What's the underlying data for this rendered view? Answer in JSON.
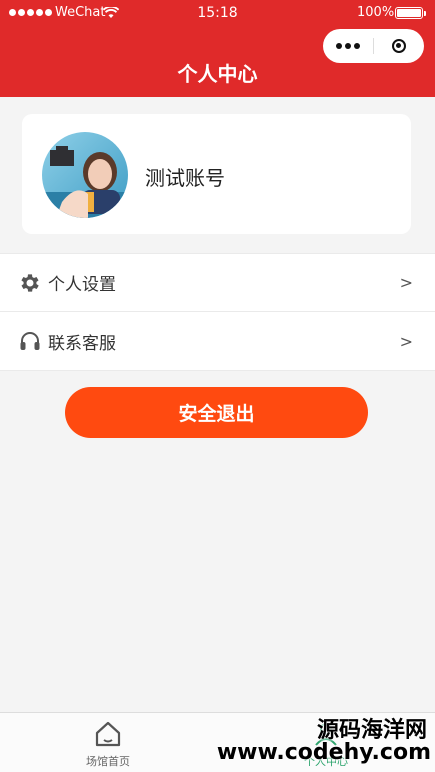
{
  "status_bar": {
    "carrier": "WeChat",
    "time": "15:18",
    "battery": "100%"
  },
  "nav": {
    "title": "个人中心"
  },
  "profile": {
    "name": "测试账号"
  },
  "menu": {
    "items": [
      {
        "label": "个人设置",
        "icon": "gear-icon",
        "arrow": ">"
      },
      {
        "label": "联系客服",
        "icon": "headset-icon",
        "arrow": ">"
      }
    ]
  },
  "logout": {
    "label": "安全退出"
  },
  "tabbar": {
    "items": [
      {
        "label": "场馆首页",
        "icon": "home-icon"
      },
      {
        "label": "个人中心",
        "icon": "user-icon",
        "active": true
      }
    ]
  },
  "watermark": {
    "line1": "源码海洋网",
    "line2": "www.codehy.com"
  },
  "colors": {
    "header": "#e02a2a",
    "logout_button": "#ff4a10",
    "background": "#f4f4f4",
    "active_tab": "#2aa36b"
  }
}
